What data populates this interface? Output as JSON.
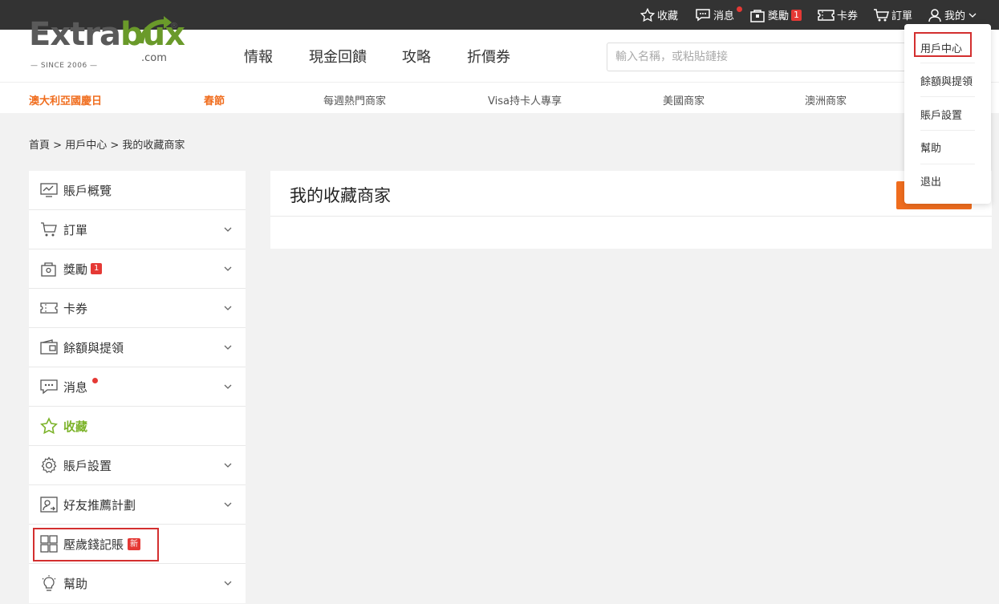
{
  "topbar": {
    "favorites": "收藏",
    "messages": "消息",
    "rewards": "獎勵",
    "rewards_count": "1",
    "cards": "卡券",
    "orders": "訂單",
    "mine": "我的"
  },
  "logo": {
    "name_part1": "Extra",
    "name_part2": "bux",
    "domain": ".com",
    "since": "— SINCE 2006 —",
    "registered": "®"
  },
  "main_nav": [
    "情報",
    "現金回饋",
    "攻略",
    "折價券"
  ],
  "search": {
    "placeholder": "輸入名稱，或粘貼鏈接"
  },
  "subnav": [
    "澳大利亞國慶日",
    "春節",
    "每週熱門商家",
    "Visa持卡人專享",
    "美國商家",
    "澳洲商家"
  ],
  "breadcrumb": {
    "home": "首頁",
    "sep": ">",
    "user_center": "用戶中心",
    "current": "我的收藏商家"
  },
  "sidebar": {
    "items": [
      {
        "label": "賬戶概覽"
      },
      {
        "label": "訂單"
      },
      {
        "label": "獎勵",
        "badge": "1"
      },
      {
        "label": "卡券"
      },
      {
        "label": "餘額與提領"
      },
      {
        "label": "消息"
      },
      {
        "label": "收藏"
      },
      {
        "label": "賬戶設置"
      },
      {
        "label": "好友推薦計劃"
      },
      {
        "label": "壓歲錢記賬",
        "badge": "新"
      },
      {
        "label": "幫助"
      }
    ]
  },
  "content": {
    "title": "我的收藏商家"
  },
  "dropdown": {
    "items": [
      "用戶中心",
      "餘額與提領",
      "賬戶設置",
      "幫助",
      "退出"
    ]
  },
  "colors": {
    "accent_orange": "#f06d1e",
    "active_green": "#7cb32a",
    "topbar": "#333333",
    "badge_red": "#e53935"
  }
}
